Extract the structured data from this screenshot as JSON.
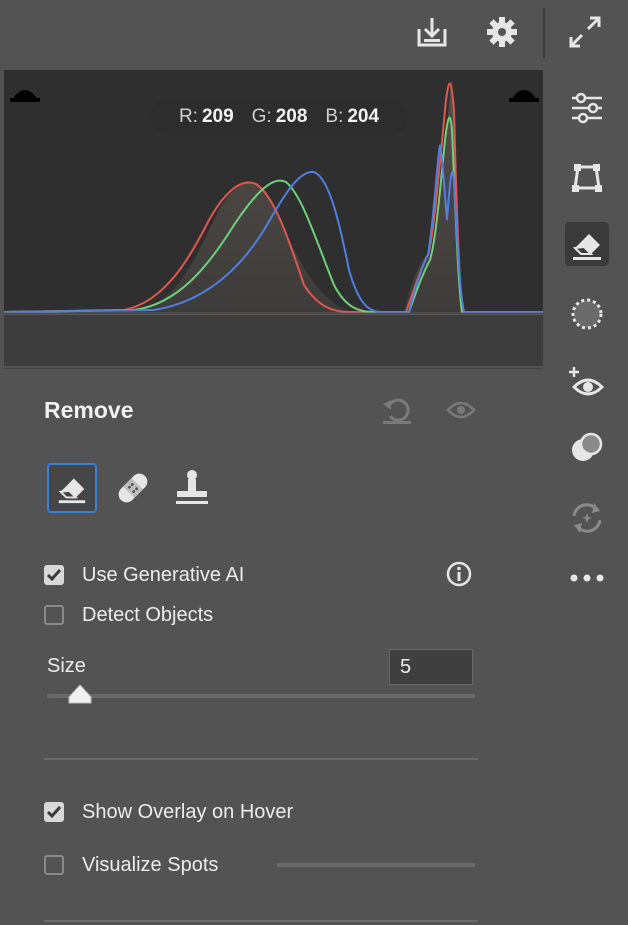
{
  "toolbar": {
    "icons": [
      "export-icon",
      "gear-icon",
      "expand-icon"
    ]
  },
  "histogram": {
    "readout": {
      "r_key": "R:",
      "r_val": "209",
      "g_key": "G:",
      "g_val": "208",
      "b_key": "B:",
      "b_val": "204"
    },
    "colors": {
      "red": "#e0574f",
      "green": "#6fd07a",
      "blue": "#4f7fe0"
    }
  },
  "rail": {
    "items": [
      {
        "icon": "adjust-sliders-icon",
        "active": false
      },
      {
        "icon": "crop-icon",
        "active": false
      },
      {
        "icon": "eraser-icon",
        "active": true
      },
      {
        "icon": "masking-icon",
        "active": false
      },
      {
        "icon": "red-eye-icon",
        "active": false
      },
      {
        "icon": "presets-icon",
        "active": false
      },
      {
        "icon": "versions-icon",
        "active": false
      },
      {
        "icon": "more-icon",
        "active": false
      }
    ]
  },
  "panel": {
    "title": "Remove",
    "tools": [
      {
        "icon": "eraser-icon",
        "active": true
      },
      {
        "icon": "bandage-icon",
        "active": false
      },
      {
        "icon": "stamp-icon",
        "active": false
      }
    ],
    "use_generative_ai": {
      "label": "Use Generative AI",
      "checked": true
    },
    "detect_objects": {
      "label": "Detect Objects",
      "checked": false
    },
    "size": {
      "label": "Size",
      "value": "5",
      "level": 0.05
    },
    "show_overlay": {
      "label": "Show Overlay on Hover",
      "checked": true
    },
    "visualize_spots": {
      "label": "Visualize Spots",
      "checked": false
    }
  },
  "colors": {
    "accent": "#3e7ecf",
    "panel_bg": "#535353",
    "histogram_bg": "#2f2f2f"
  }
}
